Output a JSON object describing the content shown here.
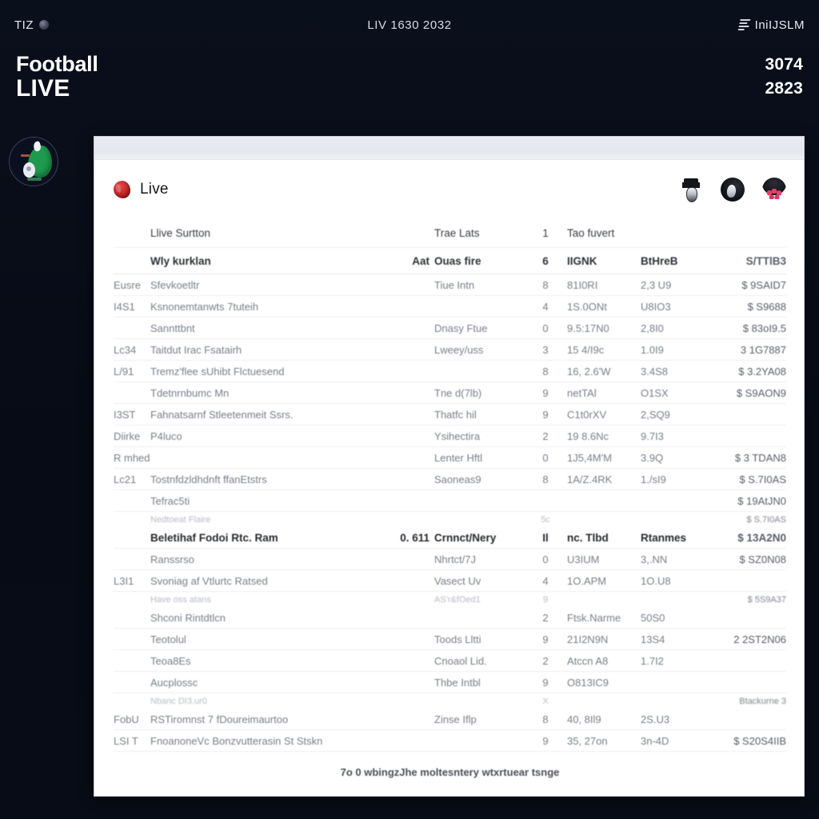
{
  "statusbar": {
    "carrier": "TIZ",
    "carrier_icon": "globe-icon",
    "center": "LIV 1630 2032",
    "signal_icon": "signal-bars-icon",
    "right": "IniIJSLM"
  },
  "hero": {
    "title_line1": "Football",
    "title_line2": "LIVE",
    "stat_primary": "3074",
    "stat_secondary": "2823"
  },
  "avatar": {
    "name": "profile-avatar",
    "accent": "#1d9a4e"
  },
  "card": {
    "live_label": "Live",
    "live_icon": "live-flame-icon",
    "header_icons": [
      {
        "name": "referee-avatar-icon"
      },
      {
        "name": "player-avatar-icon"
      },
      {
        "name": "fans-avatar-icon"
      }
    ],
    "columns": {
      "code": "",
      "name": "Llive Surtton",
      "extra": "",
      "type": "Trae Lats",
      "num": "1",
      "a": "Tao fuvert",
      "b": "",
      "amount": ""
    },
    "subheader": {
      "code": "",
      "name": "Wly kurklan",
      "extra": "Aat",
      "type": "Ouas fire",
      "num": "6",
      "a": "IIGNK",
      "b": "BtHreB",
      "amount": "S/TTlB3"
    },
    "rows": [
      {
        "code": "Eusre",
        "name": "Sfevkoetltr",
        "extra": "",
        "type": "Tiue Intn",
        "num": "8",
        "a": "81I0RI",
        "b": "2,3 U9",
        "amount": "$ 9SAID7"
      },
      {
        "code": "I4S1",
        "name": "Ksnonemtanwts 7tuteih",
        "extra": "",
        "type": "",
        "num": "4",
        "a": "1S.0ONt",
        "b": "U8IO3",
        "amount": "$  S9688"
      },
      {
        "code": "",
        "name": "Sannttbnt",
        "extra": "",
        "type": "Dnasy Ftue",
        "num": "0",
        "a": "9.5:17N0",
        "b": "2,8I0",
        "amount": "$ 83oI9.5"
      },
      {
        "code": "Lc34",
        "name": "Taitdut Irac Fsatairh",
        "extra": "",
        "type": "Lweey/uss",
        "num": "3",
        "a": "15 4/I9c",
        "b": "1.0I9",
        "amount": "3 1G7887"
      },
      {
        "code": "L/91",
        "name": "Tremz'flee sUhibt Flctuesend",
        "extra": "",
        "type": "",
        "num": "8",
        "a": "16, 2.6'W",
        "b": "3.4S8",
        "amount": "$ 3.2YA08"
      },
      {
        "code": "",
        "name": "Tdetnrnbumc Mn",
        "extra": "",
        "type": "Tne d(7lb)",
        "num": "9",
        "a": "netTAl",
        "b": "O1SX",
        "amount": "$ S9AON9"
      },
      {
        "code": "I3ST",
        "name": "Fahnatsarnf Stleetenmeit Ssrs.",
        "extra": "",
        "type": "Thatfc hil",
        "num": "9",
        "a": "C1t0rXV",
        "b": "2,SQ9",
        "amount": ""
      },
      {
        "code": "Diirke",
        "name": "P4luco",
        "extra": "",
        "type": "Ysihectira",
        "num": "2",
        "a": "19 8.6Nc",
        "b": "9.7I3",
        "amount": ""
      },
      {
        "code": "R mhed",
        "name": "",
        "extra": "",
        "type": "Lenter Hftl",
        "num": "0",
        "a": "1J5,4M'M",
        "b": "3.9Q",
        "amount": "$ 3 TDAN8"
      },
      {
        "code": "Lc21",
        "name": "Tostnfdzldhdnft ffanEtstrs",
        "extra": "",
        "type": "Saoneas9",
        "num": "8",
        "a": "1A/Z.4RK",
        "b": "1./sI9",
        "amount": "$ S.7I0AS"
      },
      {
        "code": "",
        "name": "Tefrac5ti",
        "extra": "",
        "type": "",
        "num": "",
        "a": "",
        "b": "",
        "amount": "$ 19AtJN0"
      },
      {
        "code": "",
        "name": "Nedtoeat Flaire",
        "extra": "",
        "type": "",
        "num": "5c",
        "a": "",
        "b": "",
        "amount": "$ S.7I0AS"
      },
      {
        "code": "",
        "name": "Beletihaf Fodoi Rtc. Ram",
        "extra": "0. 611",
        "type": "Crnnct/Nery",
        "num": "Il",
        "a": "nc. Tlbd",
        "b": "Rtanmes",
        "amount": "$ 13A2N0"
      },
      {
        "code": "",
        "name": "Ranssrso",
        "extra": "",
        "type": "Nhrtct/7J",
        "num": "0",
        "a": "U3IUM",
        "b": "3,.NN",
        "amount": "$ SZ0N08"
      },
      {
        "code": "L3I1",
        "name": "Svoniag af Vtlurtc Ratsed",
        "extra": "",
        "type": "Vasect Uv",
        "num": "4",
        "a": "1O.APM",
        "b": "1O.U8",
        "amount": ""
      },
      {
        "code": "",
        "name": "Have oss atans",
        "extra": "",
        "type": "AS'r&fOed1",
        "num": "9",
        "a": "",
        "b": "",
        "amount": "$ 5S9A37"
      },
      {
        "code": "",
        "name": "Shconi Rintdtlcn",
        "extra": "",
        "type": "",
        "num": "2",
        "a": "Ftsk.Narme",
        "b": "50S0",
        "amount": ""
      },
      {
        "code": "",
        "name": "Teotolul",
        "extra": "",
        "type": "Toods Lltti",
        "num": "9",
        "a": "21I2N9N",
        "b": "13S4",
        "amount": "2 2ST2N06"
      },
      {
        "code": "",
        "name": "Teoa8Es",
        "extra": "",
        "type": "Cnoaol Lid.",
        "num": "2",
        "a": "Atccn A8",
        "b": "1.7I2",
        "amount": ""
      },
      {
        "code": "",
        "name": "Aucplossc",
        "extra": "",
        "type": "Thbe Intbl",
        "num": "9",
        "a": "O813IC9",
        "b": "",
        "amount": ""
      },
      {
        "code": "",
        "name": "Nbanc DI3.ur0",
        "extra": "",
        "type": "",
        "num": "X",
        "a": "",
        "b": "",
        "amount": "Btackurne 3"
      },
      {
        "code": "FobU",
        "name": "RSTiromnst 7 fDoureimaurtoo",
        "extra": "",
        "type": "Zinse Iflp",
        "num": "8",
        "a": "40, 8Il9",
        "b": "2S.U3",
        "amount": ""
      },
      {
        "code": "LSI T",
        "name": "FnoanoneVc Bonzvutterasin St Stskn",
        "extra": "",
        "type": "",
        "num": "9",
        "a": "35, 27on",
        "b": "3n-4D",
        "amount": "$ S20S4IIB"
      }
    ],
    "footer": "7o 0 wbingzJhe moltesntery wtxrtuear tsnge"
  }
}
